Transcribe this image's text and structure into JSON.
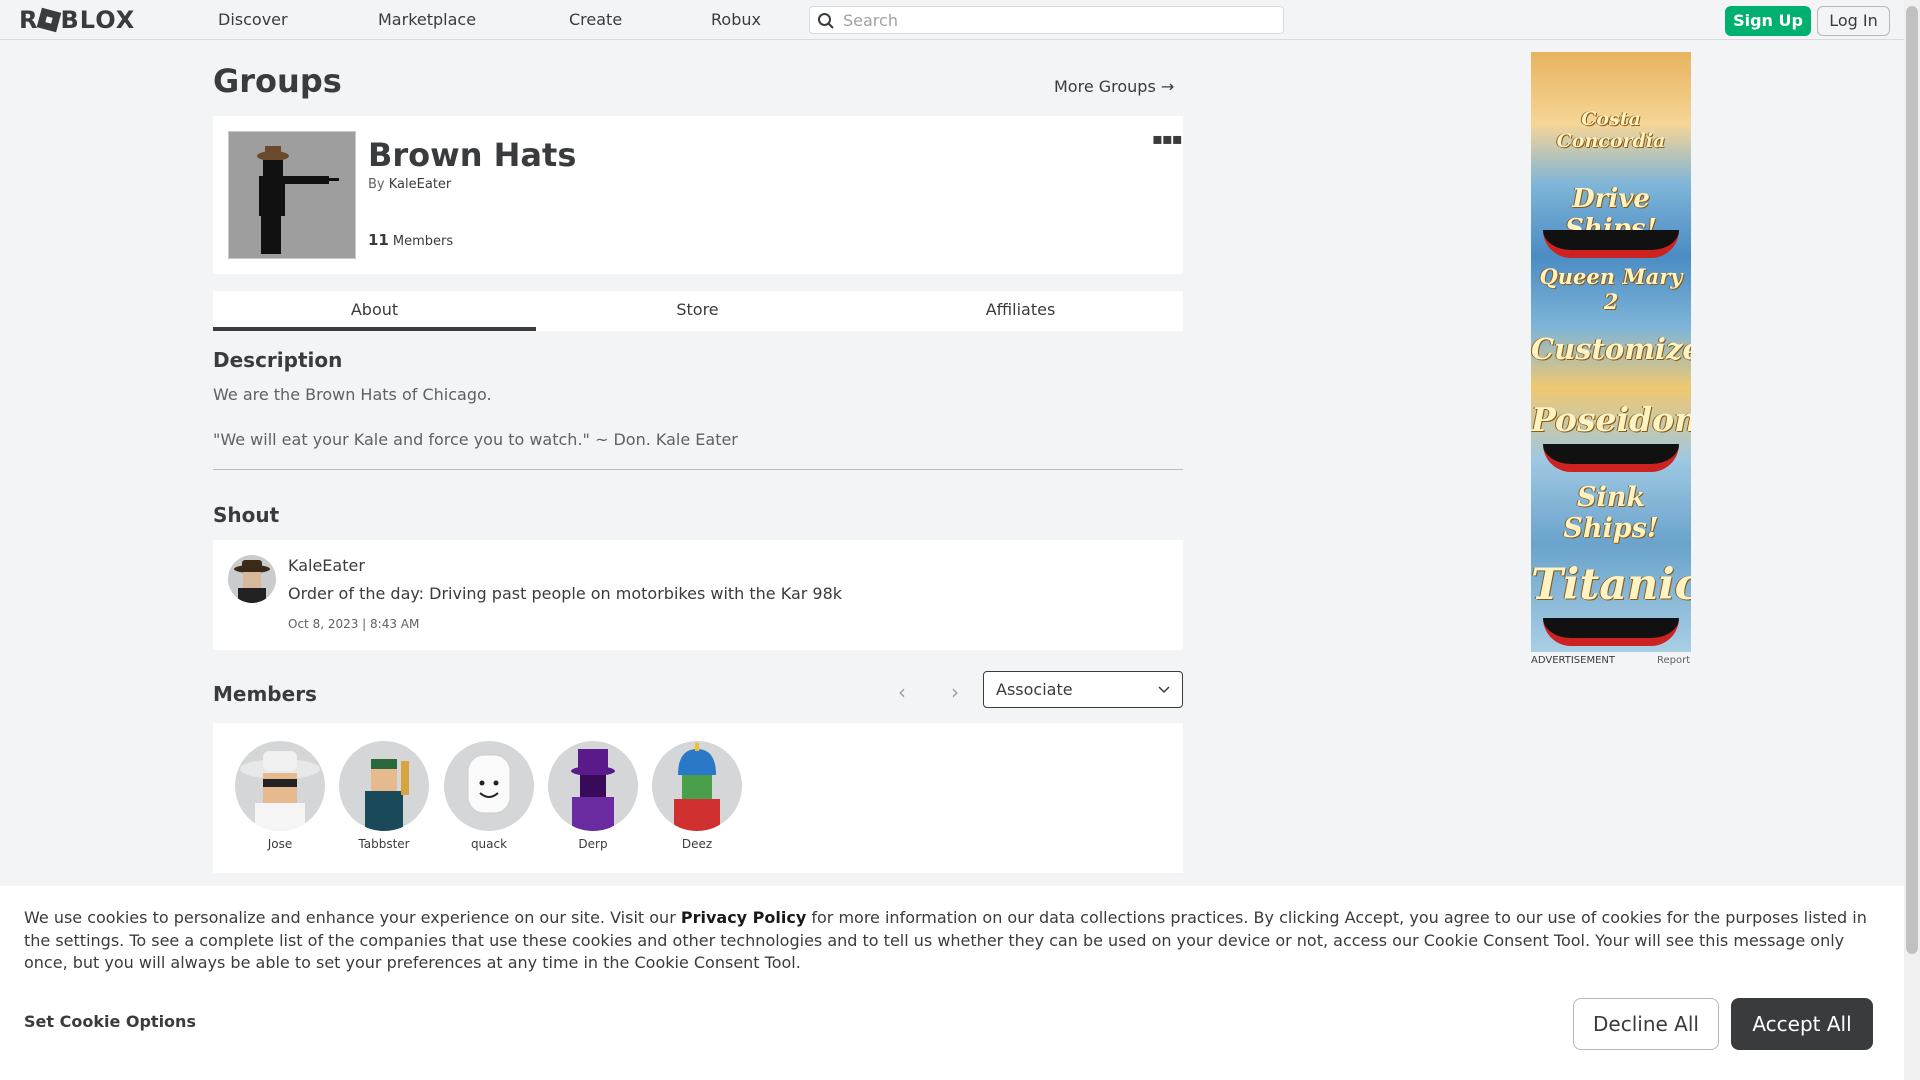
{
  "nav": {
    "logo": "ROBLOX",
    "links": [
      "Discover",
      "Marketplace",
      "Create",
      "Robux"
    ],
    "search_placeholder": "Search",
    "signup_label": "Sign Up",
    "login_label": "Log In"
  },
  "page": {
    "title": "Groups",
    "more_groups": "More Groups →"
  },
  "group": {
    "name": "Brown Hats",
    "by_label": "By",
    "owner": "KaleEater",
    "member_count": "11",
    "members_label": "Members"
  },
  "tabs": [
    "About",
    "Store",
    "Affiliates"
  ],
  "about": {
    "description_heading": "Description",
    "description_lines": [
      "We are the Brown Hats of Chicago.",
      "\"We will eat your Kale and force you to watch.\" ~ Don. Kale Eater"
    ]
  },
  "shout": {
    "heading": "Shout",
    "author": "KaleEater",
    "text": "Order of the day: Driving past people on motorbikes with the Kar 98k",
    "date": "Oct 8, 2023 | 8:43 AM"
  },
  "members": {
    "heading": "Members",
    "role_selected": "Associate",
    "list": [
      "Jose",
      "Tabbster",
      "quack",
      "Derp",
      "Deez"
    ]
  },
  "ad": {
    "texts": [
      "Costa Concordia",
      "Drive Ships!",
      "Queen Mary 2",
      "Customize!",
      "Poseidon",
      "Sink Ships!",
      "Titanic"
    ],
    "label": "ADVERTISEMENT",
    "report": "Report"
  },
  "cookie": {
    "text_before": "We use cookies to personalize and enhance your experience on our site. Visit our ",
    "privacy_link": "Privacy Policy",
    "text_after": " for more information on our data collections practices. By clicking Accept, you agree to our use of cookies for the purposes listed in the settings. To see a complete list of the companies that use these cookies and other technologies and to tell us whether they can be used on your device or not, access our Cookie Consent Tool. Your will see this message only once, but you will always be able to set your preferences at any time in the Cookie Consent Tool.",
    "set_options": "Set Cookie Options",
    "decline": "Decline All",
    "accept": "Accept All"
  },
  "colors": {
    "signup_green": "#00b06f",
    "text_dark": "#393b3d",
    "accept_bg": "#393b3d"
  }
}
